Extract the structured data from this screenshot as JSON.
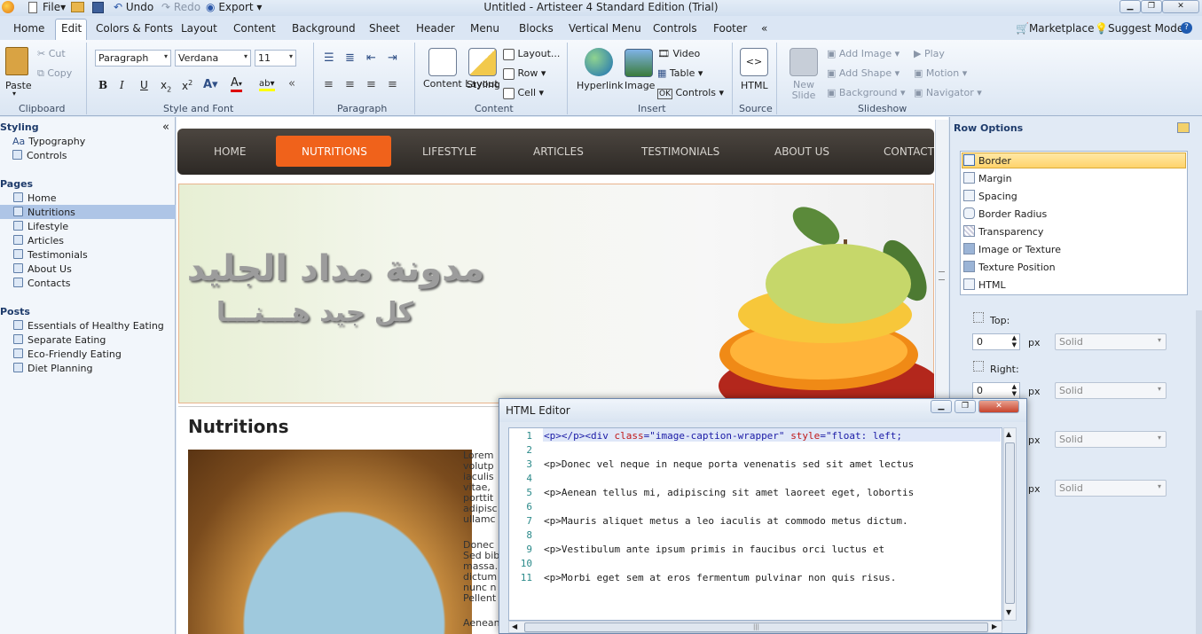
{
  "app": {
    "title": "Untitled - Artisteer 4 Standard Edition (Trial)"
  },
  "quick_access": {
    "file": "File",
    "undo": "Undo",
    "redo": "Redo",
    "export": "Export"
  },
  "tabs": [
    "Home",
    "Edit",
    "Colors & Fonts",
    "Layout",
    "Content",
    "Background",
    "Sheet",
    "Header",
    "Menu",
    "Blocks",
    "Vertical Menu",
    "Controls",
    "Footer",
    "«"
  ],
  "tabbar_right": {
    "marketplace": "Marketplace",
    "suggest_mode": "Suggest Mode"
  },
  "ribbon": {
    "clipboard": {
      "paste": "Paste",
      "cut": "Cut",
      "copy": "Copy",
      "label": "Clipboard"
    },
    "style_font": {
      "paragraph": "Paragraph",
      "font": "Verdana",
      "size": "11",
      "label": "Style and Font"
    },
    "paragraph": {
      "label": "Paragraph"
    },
    "content": {
      "content_layout": "Content Layout",
      "styling": "Styling",
      "layout": "Layout...",
      "row": "Row",
      "cell": "Cell",
      "label": "Content"
    },
    "insert": {
      "hyperlink": "Hyperlink",
      "image": "Image",
      "video": "Video",
      "table": "Table",
      "controls": "Controls",
      "label": "Insert"
    },
    "source": {
      "html": "HTML",
      "label": "Source"
    },
    "slideshow": {
      "new_slide": "New Slide",
      "add_image": "Add Image",
      "add_shape": "Add Shape",
      "background": "Background",
      "play": "Play",
      "motion": "Motion",
      "navigator": "Navigator",
      "label": "Slideshow"
    }
  },
  "left_panel": {
    "collapse": "«",
    "styling_header": "Styling",
    "styling_items": [
      "Typography",
      "Controls"
    ],
    "typography_prefix": "Aa",
    "pages_header": "Pages",
    "pages": [
      "Home",
      "Nutritions",
      "Lifestyle",
      "Articles",
      "Testimonials",
      "About Us",
      "Contacts"
    ],
    "selected_page": "Nutritions",
    "posts_header": "Posts",
    "posts": [
      "Essentials of Healthy Eating",
      "Separate Eating",
      "Eco-Friendly Eating",
      "Diet Planning"
    ]
  },
  "site": {
    "nav": [
      "HOME",
      "NUTRITIONS",
      "LIFESTYLE",
      "ARTICLES",
      "TESTIMONIALS",
      "ABOUT US",
      "CONTACT"
    ],
    "active_nav": "NUTRITIONS",
    "header_title": "مدونة مداد الجليد",
    "header_slogan": "كل جيد هـــنـــا",
    "page_heading": "Nutritions",
    "lorem_lines_1": [
      "Lorem",
      "volutp",
      "iaculis",
      "vitae,",
      "porttit",
      "adipisc",
      "ullamc"
    ],
    "lorem_lines_2": [
      "Donec",
      "Sed bib",
      "massa.",
      "dictum",
      "nunc n",
      "Pellent"
    ],
    "lorem_last": "Aenean"
  },
  "right_panel": {
    "title": "Row Options",
    "options": [
      "Border",
      "Margin",
      "Spacing",
      "Border Radius",
      "Transparency",
      "Image or Texture",
      "Texture Position",
      "HTML"
    ],
    "selected": "Border",
    "top_label": "Top:",
    "right_label": "Right:",
    "top_value": "0",
    "right_value": "0",
    "unit": "px",
    "style_value": "Solid"
  },
  "html_editor": {
    "title": "HTML Editor",
    "line_numbers": [
      "1",
      "2",
      "3",
      "4",
      "5",
      "6",
      "7",
      "8",
      "9",
      "10",
      "11"
    ],
    "lines": [
      "",
      "",
      "<p>Donec vel neque in neque porta venenatis sed sit amet lectus",
      "",
      "<p>Aenean tellus mi, adipiscing sit amet laoreet eget, lobortis",
      "",
      "<p>Mauris aliquet metus a leo iaculis at commodo metus dictum.",
      "",
      "<p>Vestibulum ante ipsum primis in faucibus orci luctus et",
      "",
      "<p>Morbi eget sem at eros fermentum pulvinar non quis risus."
    ],
    "line1_parts": [
      "<p></p><div ",
      "class",
      "=",
      "\"image-caption-wrapper\"",
      " ",
      "style",
      "=",
      "\"float: left;"
    ],
    "hscroll_grip": "|||"
  },
  "colors": {
    "nav_active": "#f0621b",
    "nav_bg": "#3a3531",
    "selection": "#ffd36b",
    "page_selection": "#aec5e6"
  }
}
